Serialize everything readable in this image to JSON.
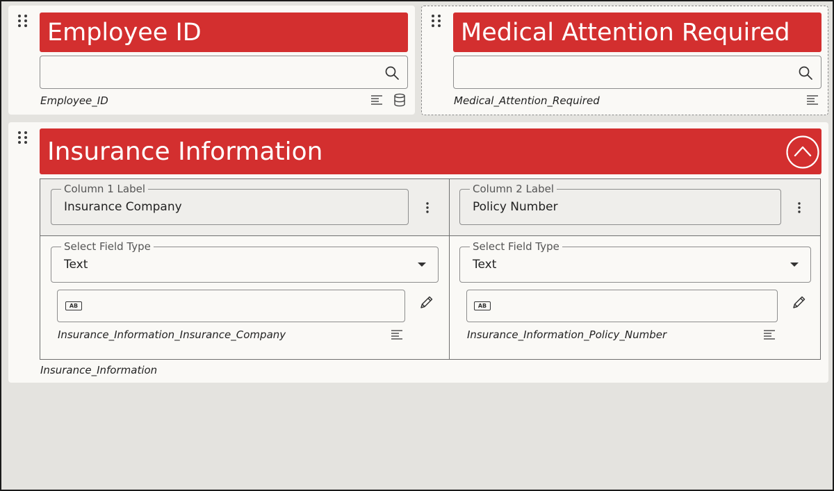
{
  "employee_id": {
    "title": "Employee ID",
    "field_name": "Employee_ID",
    "icons": [
      "search-icon",
      "align-left-icon",
      "database-icon"
    ]
  },
  "medical_attention": {
    "title": "Medical Attention Required",
    "field_name": "Medical_Attention_Required",
    "icons": [
      "search-icon",
      "align-left-icon"
    ]
  },
  "insurance": {
    "title": "Insurance Information",
    "field_name": "Insurance_Information",
    "collapse_icon": "chevron-up-icon",
    "columns": [
      {
        "label_legend": "Column 1 Label",
        "label_value": "Insurance Company",
        "type_legend": "Select Field Type",
        "type_value": "Text",
        "badge": "AB",
        "field_name": "Insurance_Information_Insurance_Company"
      },
      {
        "label_legend": "Column 2 Label",
        "label_value": "Policy Number",
        "type_legend": "Select Field Type",
        "type_value": "Text",
        "badge": "AB",
        "field_name": "Insurance_Information_Policy_Number"
      }
    ]
  },
  "colors": {
    "header_red": "#d32f2f",
    "card_bg": "#faf9f6",
    "page_bg": "#e4e3df"
  }
}
